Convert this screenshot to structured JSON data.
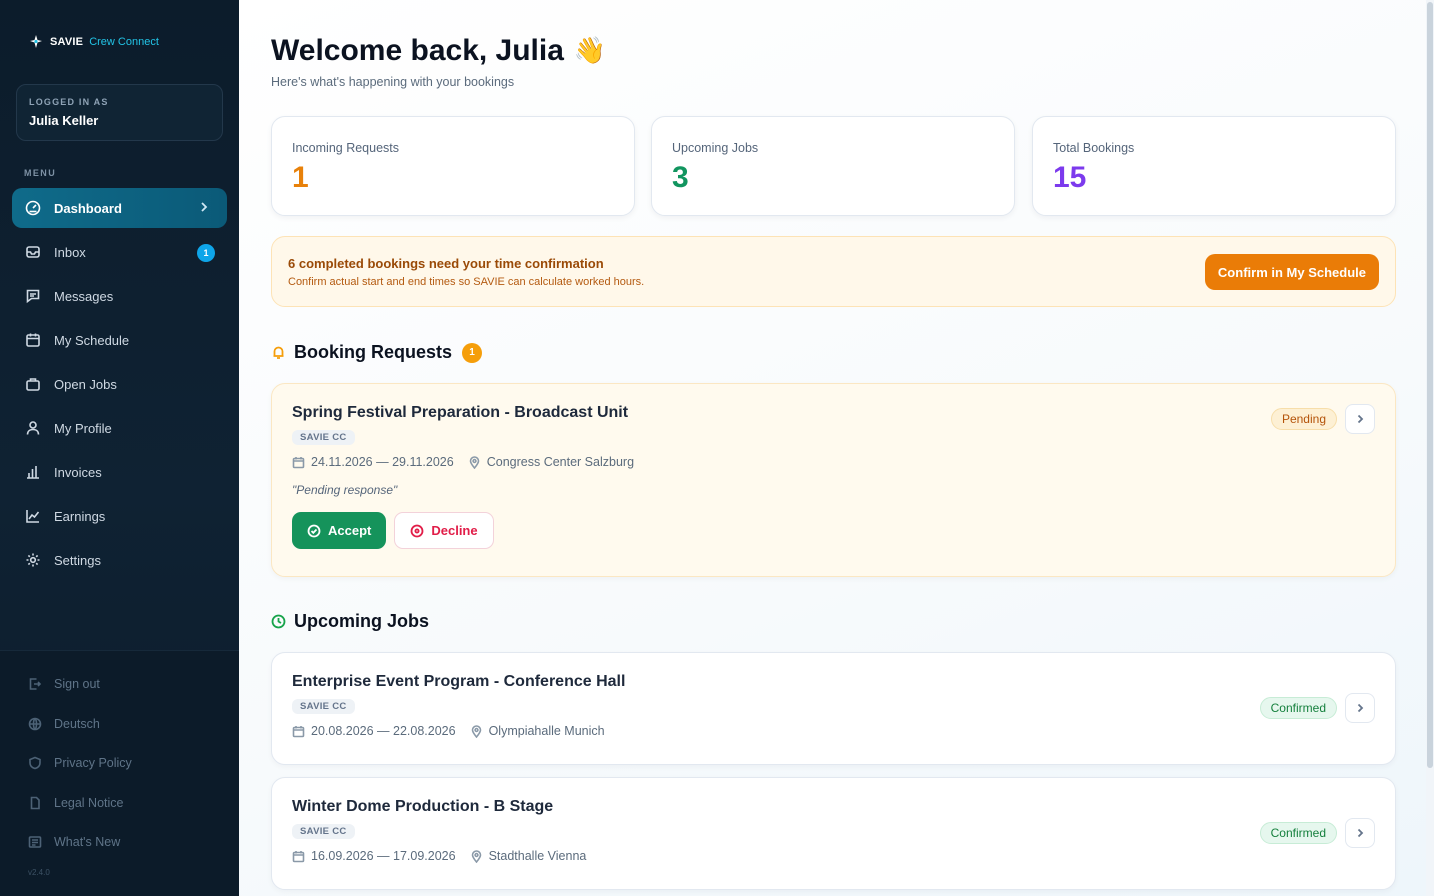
{
  "brand": {
    "name": "SAVIE",
    "product": "Crew Connect"
  },
  "user": {
    "logged_in_label": "LOGGED IN AS",
    "name": "Julia Keller"
  },
  "menu": {
    "label": "MENU",
    "items": [
      {
        "label": "Dashboard",
        "icon": "gauge-icon",
        "active": true
      },
      {
        "label": "Inbox",
        "icon": "inbox-icon",
        "badge": "1"
      },
      {
        "label": "Messages",
        "icon": "message-icon"
      },
      {
        "label": "My Schedule",
        "icon": "calendar-icon"
      },
      {
        "label": "Open Jobs",
        "icon": "briefcase-icon"
      },
      {
        "label": "My Profile",
        "icon": "user-icon"
      },
      {
        "label": "Invoices",
        "icon": "bar-chart-icon"
      },
      {
        "label": "Earnings",
        "icon": "line-chart-icon"
      },
      {
        "label": "Settings",
        "icon": "gear-icon"
      }
    ]
  },
  "footer": {
    "items": [
      {
        "label": "Sign out",
        "icon": "sign-out-icon"
      },
      {
        "label": "Deutsch",
        "icon": "globe-icon"
      },
      {
        "label": "Privacy Policy",
        "icon": "shield-icon"
      },
      {
        "label": "Legal Notice",
        "icon": "document-icon"
      },
      {
        "label": "What's New",
        "icon": "news-icon"
      }
    ],
    "version": "v2.4.0"
  },
  "header": {
    "title": "Welcome back, Julia",
    "emoji": "👋",
    "subtitle": "Here's what's happening with your bookings"
  },
  "stats": [
    {
      "label": "Incoming Requests",
      "value": "1",
      "color": "#e8810a"
    },
    {
      "label": "Upcoming Jobs",
      "value": "3",
      "color": "#11955f"
    },
    {
      "label": "Total Bookings",
      "value": "15",
      "color": "#7c3aed"
    }
  ],
  "alert": {
    "title": "6 completed bookings need your time confirmation",
    "text": "Confirm actual start and end times so SAVIE can calculate worked hours.",
    "button": "Confirm in My Schedule"
  },
  "booking_requests": {
    "title": "Booking Requests",
    "count": "1",
    "items": [
      {
        "title": "Spring Festival Preparation - Broadcast Unit",
        "tag": "SAVIE CC",
        "dates": "24.11.2026 — 29.11.2026",
        "location": "Congress Center Salzburg",
        "note": "\"Pending response\"",
        "status": "Pending",
        "accept": "Accept",
        "decline": "Decline"
      }
    ]
  },
  "upcoming_jobs": {
    "title": "Upcoming Jobs",
    "items": [
      {
        "title": "Enterprise Event Program - Conference Hall",
        "tag": "SAVIE CC",
        "dates": "20.08.2026 — 22.08.2026",
        "location": "Olympiahalle Munich",
        "status": "Confirmed"
      },
      {
        "title": "Winter Dome Production - B Stage",
        "tag": "SAVIE CC",
        "dates": "16.09.2026 — 17.09.2026",
        "location": "Stadthalle Vienna",
        "status": "Confirmed"
      }
    ]
  }
}
